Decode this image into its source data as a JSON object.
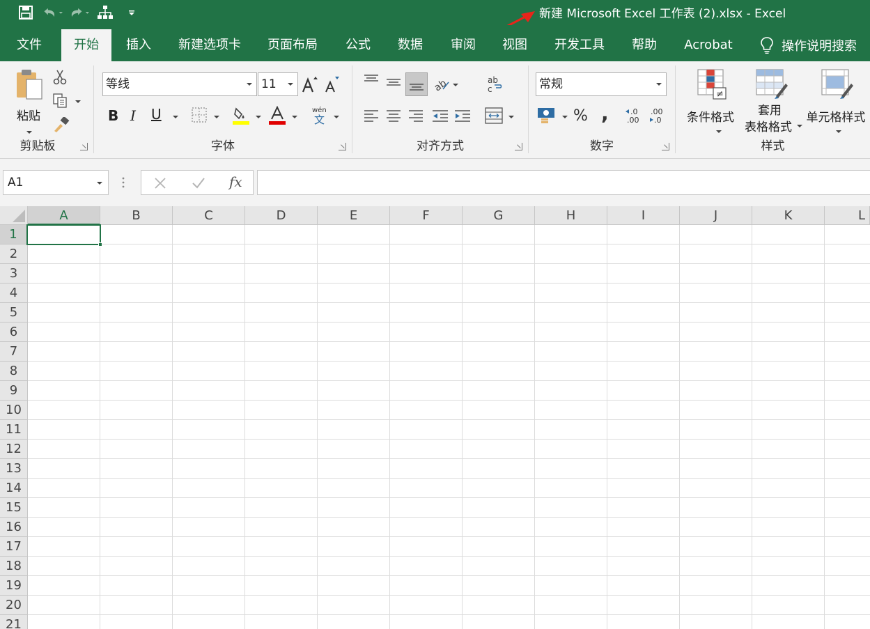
{
  "window": {
    "title": "新建 Microsoft Excel 工作表 (2).xlsx  -  Excel"
  },
  "quick_access": {
    "icons": [
      "save-icon",
      "undo-icon",
      "redo-icon",
      "org-chart-icon",
      "customize-qat-icon"
    ]
  },
  "tabs": [
    {
      "label": "文件"
    },
    {
      "label": "开始"
    },
    {
      "label": "插入"
    },
    {
      "label": "新建选项卡"
    },
    {
      "label": "页面布局"
    },
    {
      "label": "公式"
    },
    {
      "label": "数据"
    },
    {
      "label": "审阅"
    },
    {
      "label": "视图"
    },
    {
      "label": "开发工具"
    },
    {
      "label": "帮助"
    },
    {
      "label": "Acrobat"
    }
  ],
  "active_tab": "开始",
  "tell_me": "操作说明搜索",
  "ribbon": {
    "clipboard": {
      "label": "剪贴板",
      "paste_label": "粘贴"
    },
    "font": {
      "label": "字体",
      "font_name": "等线",
      "font_size": "11",
      "phonetic": "wén\n文"
    },
    "alignment": {
      "label": "对齐方式"
    },
    "number": {
      "label": "数字",
      "format": "常规",
      "percent": "%",
      "comma": ","
    },
    "styles": {
      "label": "样式",
      "conditional_formatting": "条件格式",
      "format_as_table_line1": "套用",
      "format_as_table_line2": "表格格式",
      "cell_styles": "单元格样式"
    }
  },
  "formula_bar": {
    "name_box": "A1",
    "formula": ""
  },
  "sheet": {
    "columns": [
      "A",
      "B",
      "C",
      "D",
      "E",
      "F",
      "G",
      "H",
      "I",
      "J",
      "K",
      "L"
    ],
    "rows": [
      "1",
      "2",
      "3",
      "4",
      "5",
      "6",
      "7",
      "8",
      "9",
      "10",
      "11",
      "12",
      "13",
      "14",
      "15",
      "16",
      "17",
      "18",
      "19",
      "20",
      "21"
    ],
    "selected_cell": "A1"
  },
  "colors": {
    "excel_green": "#217346",
    "ribbon_bg": "#f3f3f3",
    "highlight_yellow": "#ffff00",
    "font_red": "#e00000",
    "annotation_arrow": "#e8251a"
  }
}
